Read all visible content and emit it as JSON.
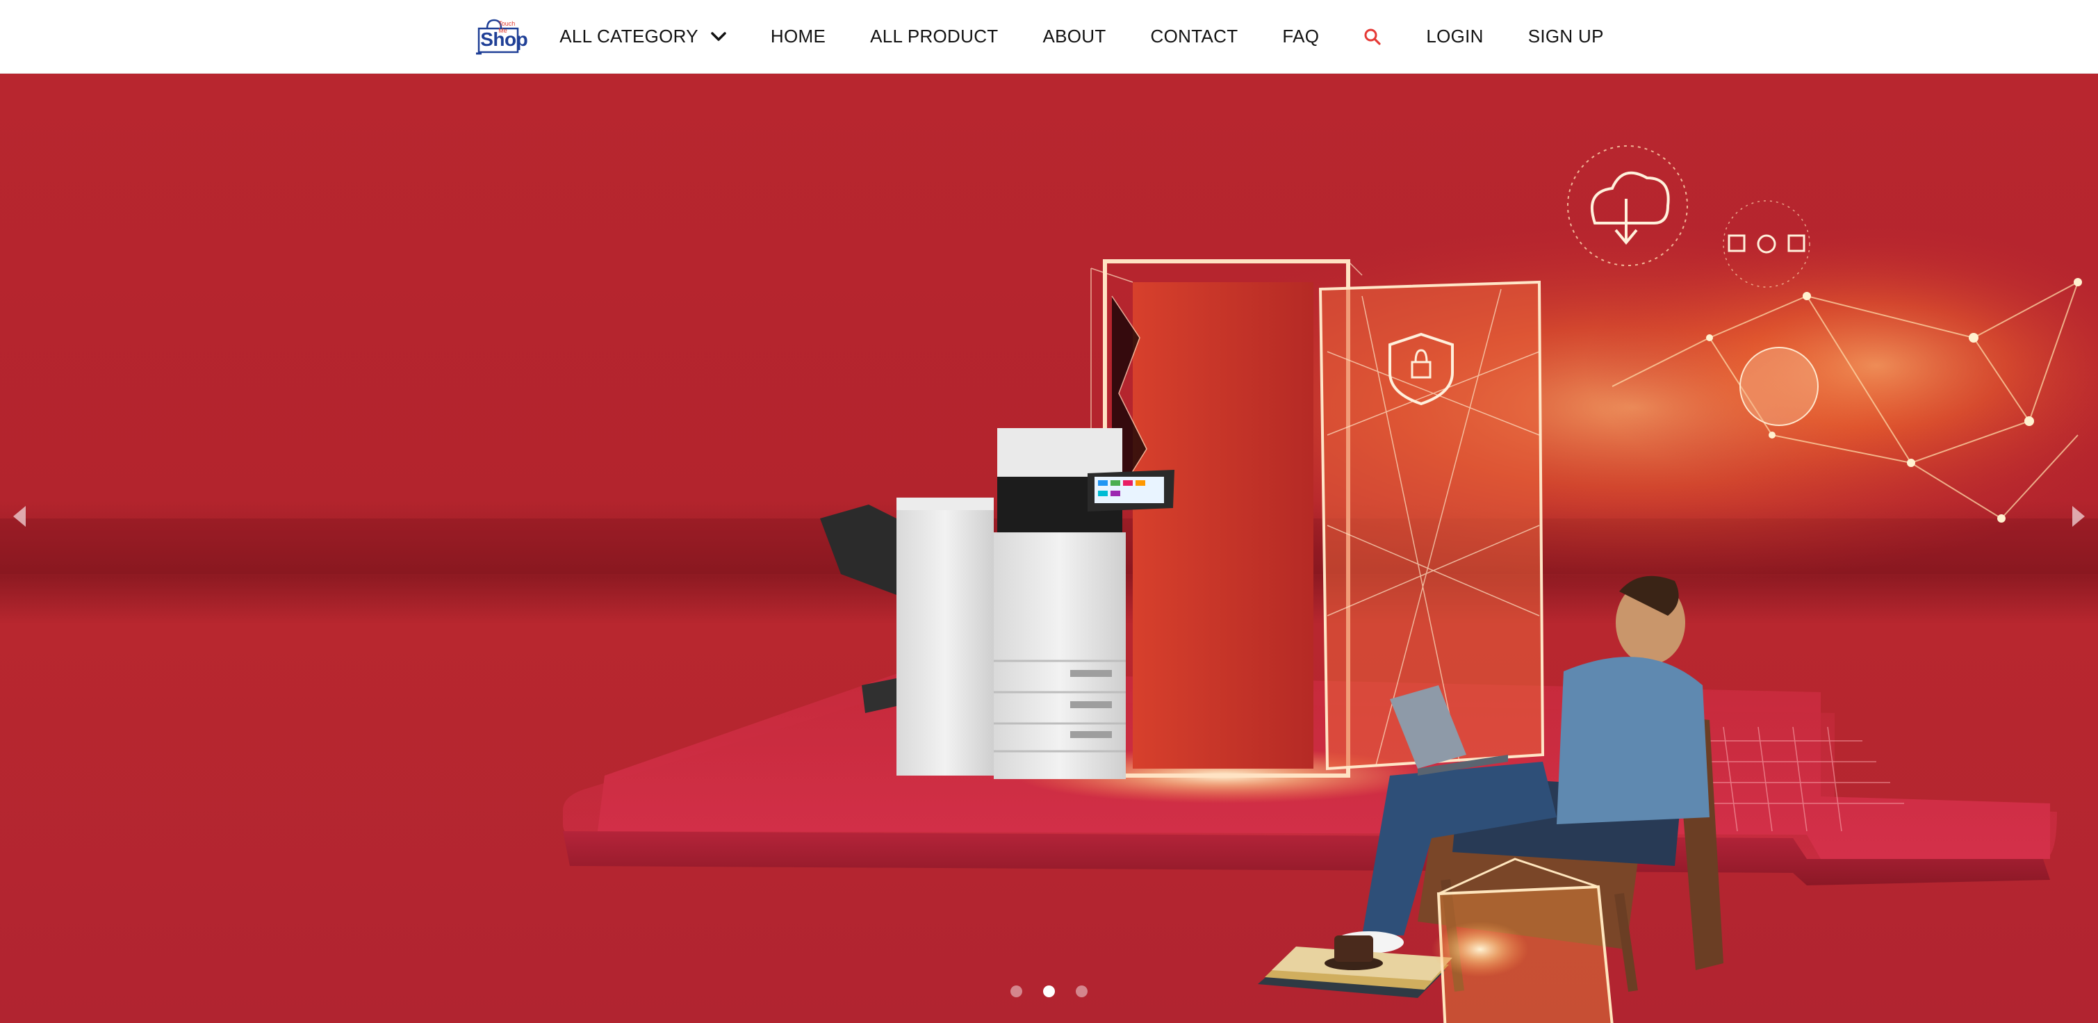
{
  "brand": {
    "logo_small_text": "Touch Me",
    "logo_text": "Shop",
    "logo_color": "#1f3f96",
    "logo_accent": "#e03a2f"
  },
  "nav": {
    "items": [
      {
        "label": "ALL CATEGORY",
        "has_dropdown": true
      },
      {
        "label": "HOME"
      },
      {
        "label": "ALL PRODUCT"
      },
      {
        "label": "ABOUT"
      },
      {
        "label": "CONTACT"
      },
      {
        "label": "FAQ"
      }
    ],
    "search_icon": "search-icon",
    "search_color": "#e53935",
    "login_label": "LOGIN",
    "signup_label": "SIGN UP"
  },
  "hero": {
    "slide_count": 3,
    "active_slide": 2,
    "background_color": "#b3242d",
    "prev_icon": "triangle-left-icon",
    "next_icon": "triangle-right-icon"
  }
}
